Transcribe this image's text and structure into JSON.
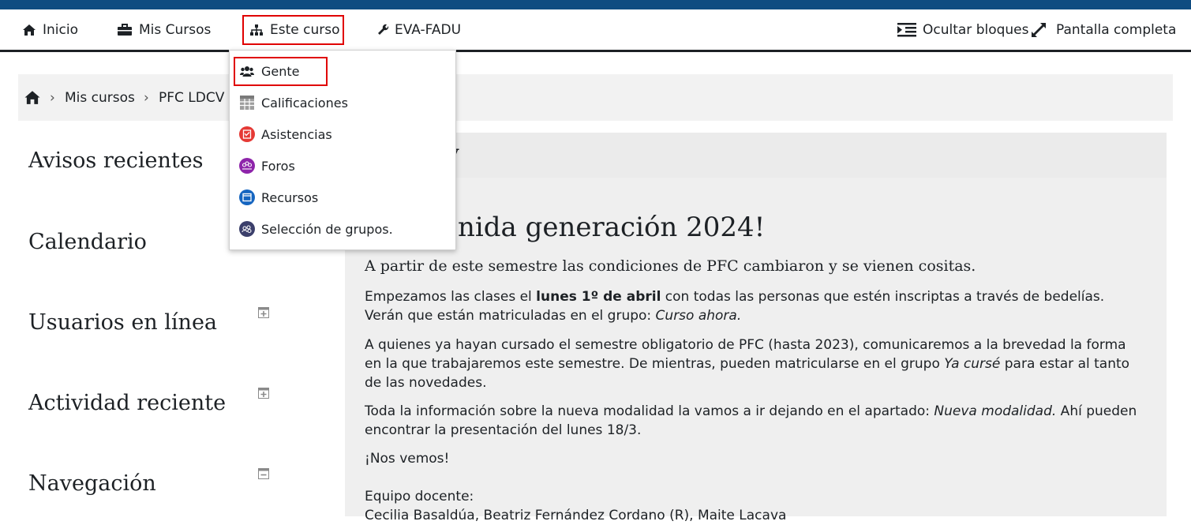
{
  "navbar": {
    "inicio": "Inicio",
    "mis_cursos": "Mis Cursos",
    "este_curso": "Este curso",
    "eva_fadu": "EVA-FADU",
    "ocultar_bloques": "Ocultar bloques",
    "pantalla_completa": "Pantalla completa"
  },
  "dropdown": {
    "items": [
      {
        "label": "Gente",
        "icon": "users-icon"
      },
      {
        "label": "Calificaciones",
        "icon": "table-icon"
      },
      {
        "label": "Asistencias",
        "icon": "attendance-icon"
      },
      {
        "label": "Foros",
        "icon": "forum-icon"
      },
      {
        "label": "Recursos",
        "icon": "resource-icon"
      },
      {
        "label": "Selección de grupos.",
        "icon": "group-selection-icon"
      }
    ]
  },
  "breadcrumb": {
    "items": [
      "Mis cursos",
      "PFC LDCV"
    ],
    "separator": "›"
  },
  "sidebar": {
    "blocks": [
      "Avisos recientes",
      "Calendario",
      "Usuarios en línea",
      "Actividad reciente",
      "Navegación"
    ]
  },
  "main": {
    "header_fragment": "v",
    "title": "nida generación 2024!",
    "subtitle": "A partir de este semestre las condiciones de PFC cambiaron y se vienen cositas.",
    "p1": {
      "before": "Empezamos las clases el ",
      "bold": "lunes 1º de abril",
      "after": " con todas las personas que estén inscriptas a través de bedelías. Verán que están matriculadas en el grupo: ",
      "italic": "Curso ahora."
    },
    "p2": {
      "before": "A quienes ya hayan cursado el semestre obligatorio de PFC (hasta 2023), comunicaremos a la brevedad la forma en la que trabajaremos este semestre. De mientras, pueden matricularse en el grupo ",
      "italic": "Ya cursé",
      "after": " para estar al tanto de las novedades."
    },
    "p3": {
      "before": "Toda la información sobre la nueva modalidad la vamos a ir dejando en el apartado: ",
      "italic": "Nueva modalidad.",
      "after": " Ahí pueden encontrar la presentación del lunes 18/3."
    },
    "p4": "¡Nos vemos!",
    "p5": "Equipo docente:",
    "p6": "Cecilia Basaldúa, Beatriz Fernández Cordano (R), Maite Lacava"
  },
  "colors": {
    "topbar": "#0f4c81",
    "highlight": "#e00000",
    "asistencias": "#e53935",
    "foros": "#8e24aa",
    "recursos": "#1565c0",
    "seleccion": "#3b3f6b"
  }
}
